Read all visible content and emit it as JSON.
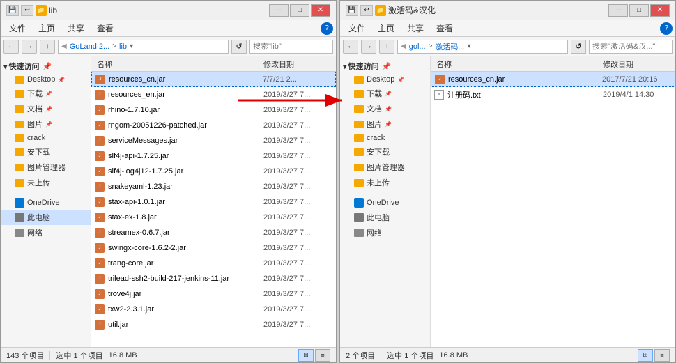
{
  "left_window": {
    "title": "lib",
    "menu_items": [
      "文件",
      "主页",
      "共享",
      "查看"
    ],
    "path_segments": [
      "GoLand 2...",
      "lib"
    ],
    "search_placeholder": "搜索\"lib\"",
    "quick_access_label": "快速访问",
    "sidebar_items": [
      {
        "label": "Desktop",
        "pinned": true
      },
      {
        "label": "下载",
        "pinned": true
      },
      {
        "label": "文档",
        "pinned": true
      },
      {
        "label": "图片",
        "pinned": true
      },
      {
        "label": "crack",
        "pinned": false
      },
      {
        "label": "安下载",
        "pinned": false
      },
      {
        "label": "图片管理器",
        "pinned": false
      },
      {
        "label": "未上传",
        "pinned": false
      },
      {
        "label": "OneDrive",
        "pinned": false
      },
      {
        "label": "此电脑",
        "pinned": false
      },
      {
        "label": "网络",
        "pinned": false
      }
    ],
    "files": [
      {
        "name": "resources_cn.jar",
        "date": "7/7/21 2...",
        "selected": true
      },
      {
        "name": "resources_en.jar",
        "date": "2019/3/27 7..."
      },
      {
        "name": "rhino-1.7.10.jar",
        "date": "2019/3/27 7..."
      },
      {
        "name": "rngom-20051226-patched.jar",
        "date": "2019/3/27 7..."
      },
      {
        "name": "serviceMessages.jar",
        "date": "2019/3/27 7..."
      },
      {
        "name": "slf4j-api-1.7.25.jar",
        "date": "2019/3/27 7..."
      },
      {
        "name": "slf4j-log4j12-1.7.25.jar",
        "date": "2019/3/27 7..."
      },
      {
        "name": "snakeyaml-1.23.jar",
        "date": "2019/3/27 7..."
      },
      {
        "name": "stax-api-1.0.1.jar",
        "date": "2019/3/27 7..."
      },
      {
        "name": "stax-ex-1.8.jar",
        "date": "2019/3/27 7..."
      },
      {
        "name": "streamex-0.6.7.jar",
        "date": "2019/3/27 7..."
      },
      {
        "name": "swingx-core-1.6.2-2.jar",
        "date": "2019/3/27 7..."
      },
      {
        "name": "trang-core.jar",
        "date": "2019/3/27 7..."
      },
      {
        "name": "trilead-ssh2-build-217-jenkins-11.jar",
        "date": "2019/3/27 7..."
      },
      {
        "name": "trove4j.jar",
        "date": "2019/3/27 7..."
      },
      {
        "name": "txw2-2.3.1.jar",
        "date": "2019/3/27 7..."
      },
      {
        "name": "util.jar",
        "date": "2019/3/27 7..."
      }
    ],
    "status": {
      "count": "143 个项目",
      "selected": "选中 1 个项目",
      "size": "16.8 MB"
    },
    "col_name": "名称",
    "col_date": "修改日期"
  },
  "right_window": {
    "title": "激活码&汉化",
    "menu_items": [
      "文件",
      "主页",
      "共享",
      "查看"
    ],
    "path_segments": [
      "gol...",
      "激活码..."
    ],
    "search_placeholder": "搜索\"激活码&汉...\"",
    "quick_access_label": "快速访问",
    "sidebar_items": [
      {
        "label": "Desktop",
        "pinned": true
      },
      {
        "label": "下载",
        "pinned": true
      },
      {
        "label": "文档",
        "pinned": true
      },
      {
        "label": "图片",
        "pinned": true
      },
      {
        "label": "crack",
        "pinned": false
      },
      {
        "label": "安下载",
        "pinned": false
      },
      {
        "label": "图片管理器",
        "pinned": false
      },
      {
        "label": "未上传",
        "pinned": false
      },
      {
        "label": "OneDrive",
        "pinned": false
      },
      {
        "label": "此电脑",
        "pinned": false
      },
      {
        "label": "网络",
        "pinned": false
      }
    ],
    "files": [
      {
        "name": "resources_cn.jar",
        "date": "2017/7/21 20:16",
        "selected": true
      },
      {
        "name": "注册码.txt",
        "date": "2019/4/1 14:30"
      }
    ],
    "status": {
      "count": "2 个项目",
      "selected": "选中 1 个项目",
      "size": "16.8 MB"
    },
    "col_name": "名称",
    "col_date": "修改日期"
  },
  "icons": {
    "back": "←",
    "forward": "→",
    "up": "↑",
    "refresh": "↺",
    "search": "🔍",
    "help": "?",
    "minimize": "—",
    "maximize": "□",
    "close": "✕",
    "chevron_down": "▾",
    "chevron_right": "▸",
    "folder": "📁",
    "pin": "📌",
    "grid_view": "⊞",
    "list_view": "≡"
  }
}
